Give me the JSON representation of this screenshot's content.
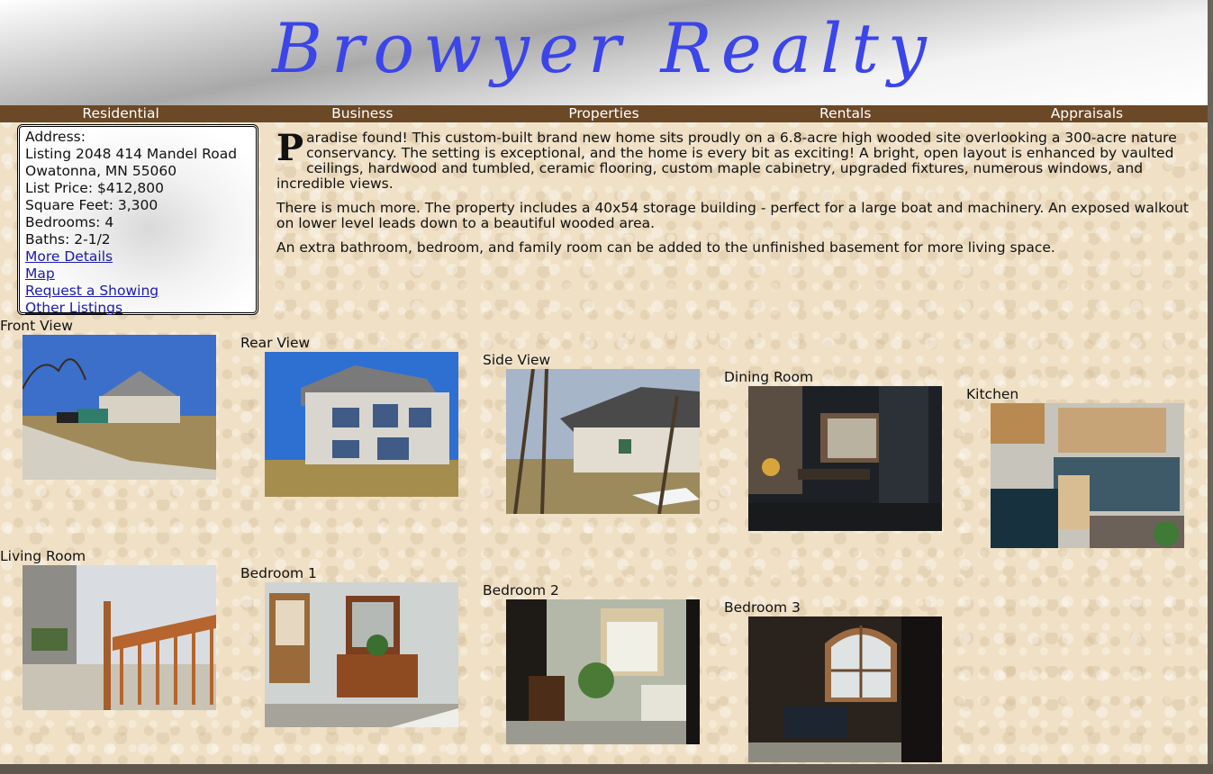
{
  "site": {
    "logo_text": "Browyer Realty"
  },
  "nav": {
    "items": [
      "Residential",
      "Business",
      "Properties",
      "Rentals",
      "Appraisals"
    ]
  },
  "listing": {
    "address_label": "Address:",
    "listing_line": "Listing 2048 414 Mandel Road",
    "city_line": "Owatonna, MN 55060",
    "price": "List Price: $412,800",
    "sqft": "Square Feet: 3,300",
    "bedrooms": "Bedrooms: 4",
    "baths": "Baths: 2-1/2",
    "links": [
      "More Details",
      "Map",
      "Request a Showing",
      "Other Listings"
    ]
  },
  "description": {
    "dropcap": "P",
    "para1": "aradise found! This custom-built brand new home sits proudly on a 6.8-acre high wooded site overlooking a 300-acre nature conservancy. The setting is exceptional, and the home is every bit as exciting! A bright, open layout is enhanced by vaulted ceilings, hardwood and tumbled, ceramic flooring, custom maple cabinetry, upgraded fixtures, numerous windows, and incredible views.",
    "para2": "There is much more. The property includes a 40x54 storage building - perfect for a large boat and machinery. An exposed walkout on lower level leads down to a beautiful wooded area.",
    "para3": "An extra bathroom, bedroom, and family room can be added to the unfinished basement for more living space."
  },
  "gallery": {
    "captions": [
      "Front View",
      "Rear View",
      "Side View",
      "Dining Room",
      "Kitchen",
      "Living Room",
      "Bedroom 1",
      "Bedroom 2",
      "Bedroom 3"
    ]
  }
}
